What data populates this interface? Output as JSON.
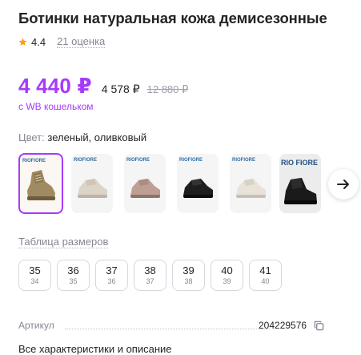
{
  "product": {
    "title": "Ботинки натуральная кожа демисезонные",
    "rating": "4.4",
    "reviews": "21 оценка"
  },
  "price": {
    "wallet_price": "4 440 ₽",
    "price": "4 578 ₽",
    "old_price": "12 880 ₽",
    "wallet_note": "с WB кошельком",
    "accent_color": "#a73afd"
  },
  "color": {
    "label": "Цвет:",
    "value": "зеленый, оливковый"
  },
  "thumbnails": [
    {
      "brand": "RIOFIORE",
      "color": "olive",
      "selected": true
    },
    {
      "brand": "RIOFIORE",
      "color": "beige",
      "selected": false
    },
    {
      "brand": "RIOFIORE",
      "color": "pink-beige",
      "selected": false
    },
    {
      "brand": "RIOFIORE",
      "color": "black",
      "selected": false
    },
    {
      "brand": "RIOFIORE",
      "color": "cream",
      "selected": false
    },
    {
      "brand": "RIO FIORE",
      "color": "black",
      "selected": false
    }
  ],
  "icons": {
    "star": "star-icon",
    "next": "arrow-right-icon",
    "copy": "copy-icon"
  },
  "size_table_label": "Таблица размеров",
  "sizes": [
    {
      "eu": "35",
      "ru": "34"
    },
    {
      "eu": "36",
      "ru": "35"
    },
    {
      "eu": "37",
      "ru": "36"
    },
    {
      "eu": "38",
      "ru": "37"
    },
    {
      "eu": "39",
      "ru": "38"
    },
    {
      "eu": "40",
      "ru": "39"
    },
    {
      "eu": "41",
      "ru": "40"
    }
  ],
  "article": {
    "label": "Артикул",
    "value": "204229576"
  },
  "all_specs_label": "Все характеристики и описание"
}
